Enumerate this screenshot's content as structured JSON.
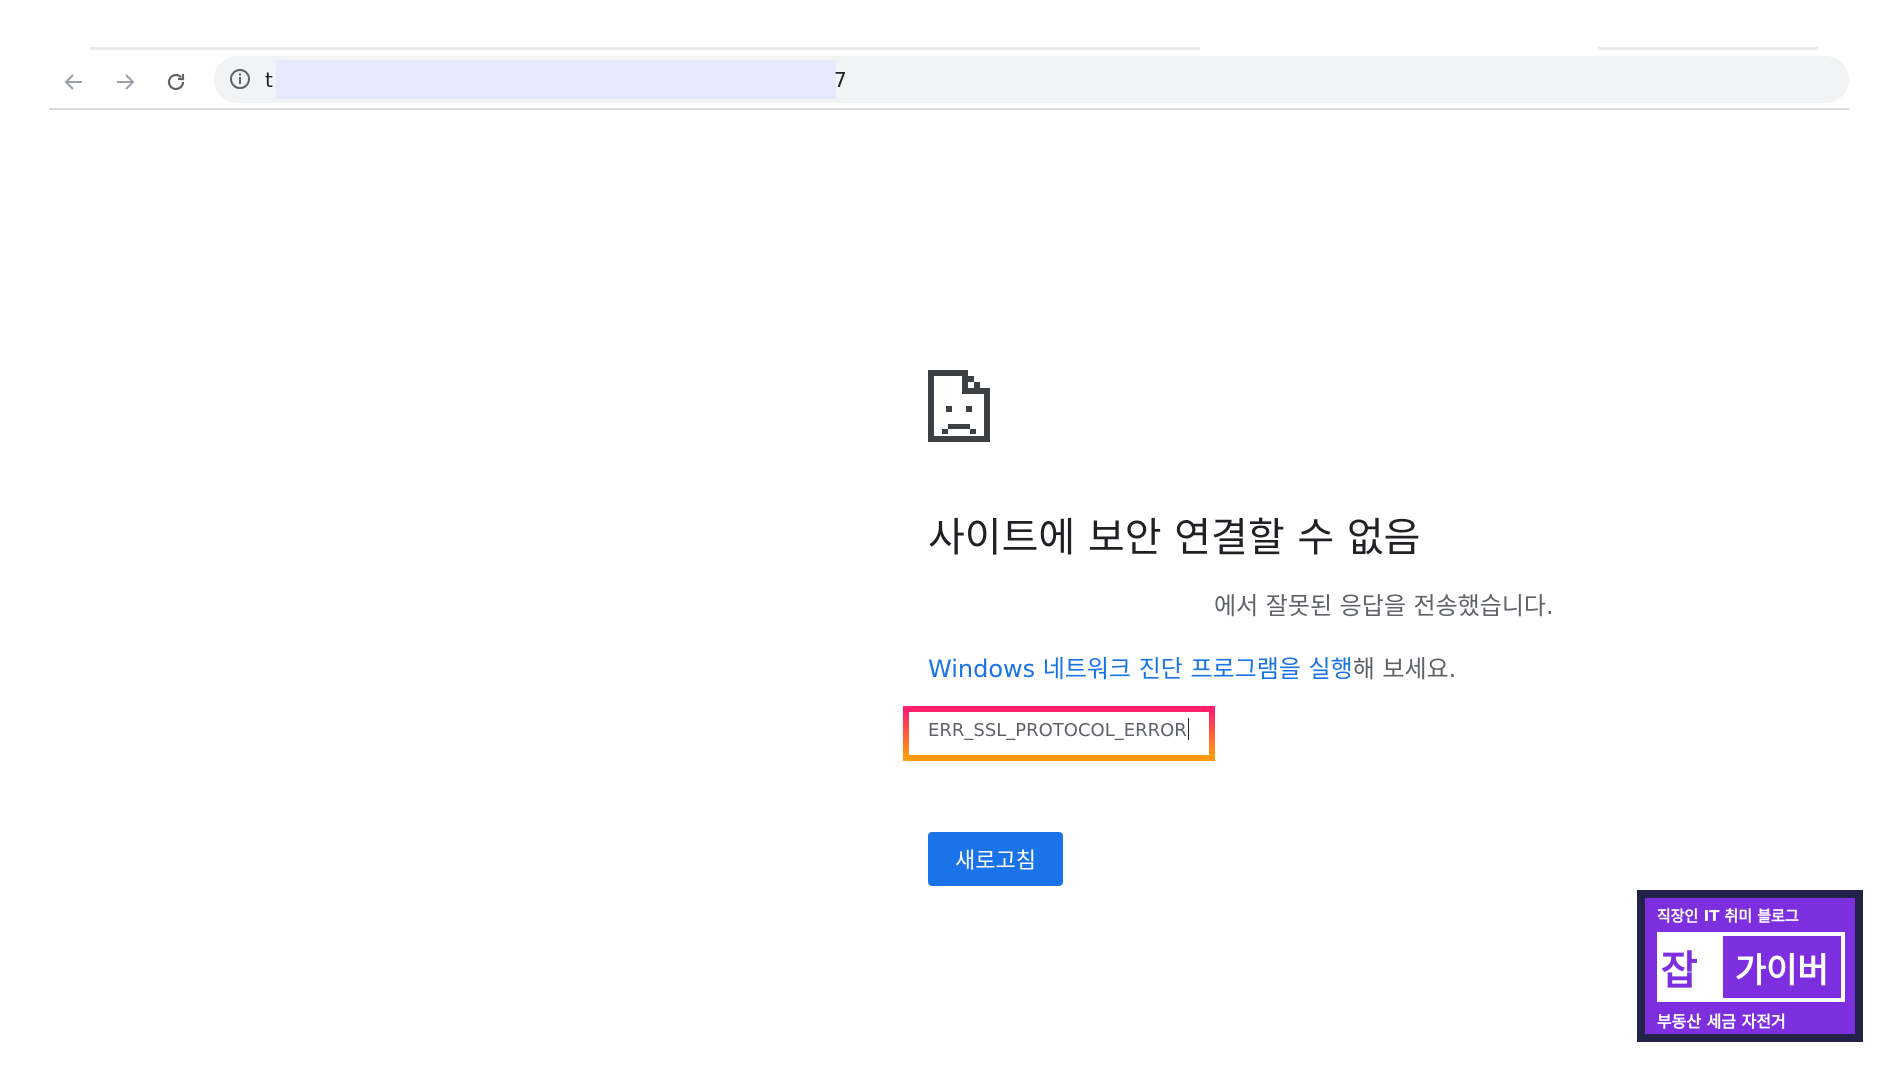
{
  "browser": {
    "back_icon": "arrow-left-icon",
    "forward_icon": "arrow-right-icon",
    "reload_icon": "reload-icon",
    "info_icon": "info-icon",
    "url_start": "t",
    "url_end": "7"
  },
  "error": {
    "icon": "sad-page-icon",
    "title": "사이트에 보안 연결할 수 없음",
    "description": "에서 잘못된 응답을 전송했습니다.",
    "suggestion_link": "Windows 네트워크 진단 프로그램을 실행",
    "suggestion_rest": "해 보세요.",
    "code": "ERR_SSL_PROTOCOL_ERROR",
    "reload_label": "새로고침"
  },
  "watermark": {
    "top_text": "직장인 IT 취미 블로그",
    "mid_left": "잡",
    "mid_right": "가이버",
    "bottom_text": "부동산 세금 자전거"
  },
  "colors": {
    "link": "#1a73e8",
    "button": "#1a73e8",
    "highlight_border": "#ff1f6e",
    "watermark_bg": "#7d2fe0"
  }
}
